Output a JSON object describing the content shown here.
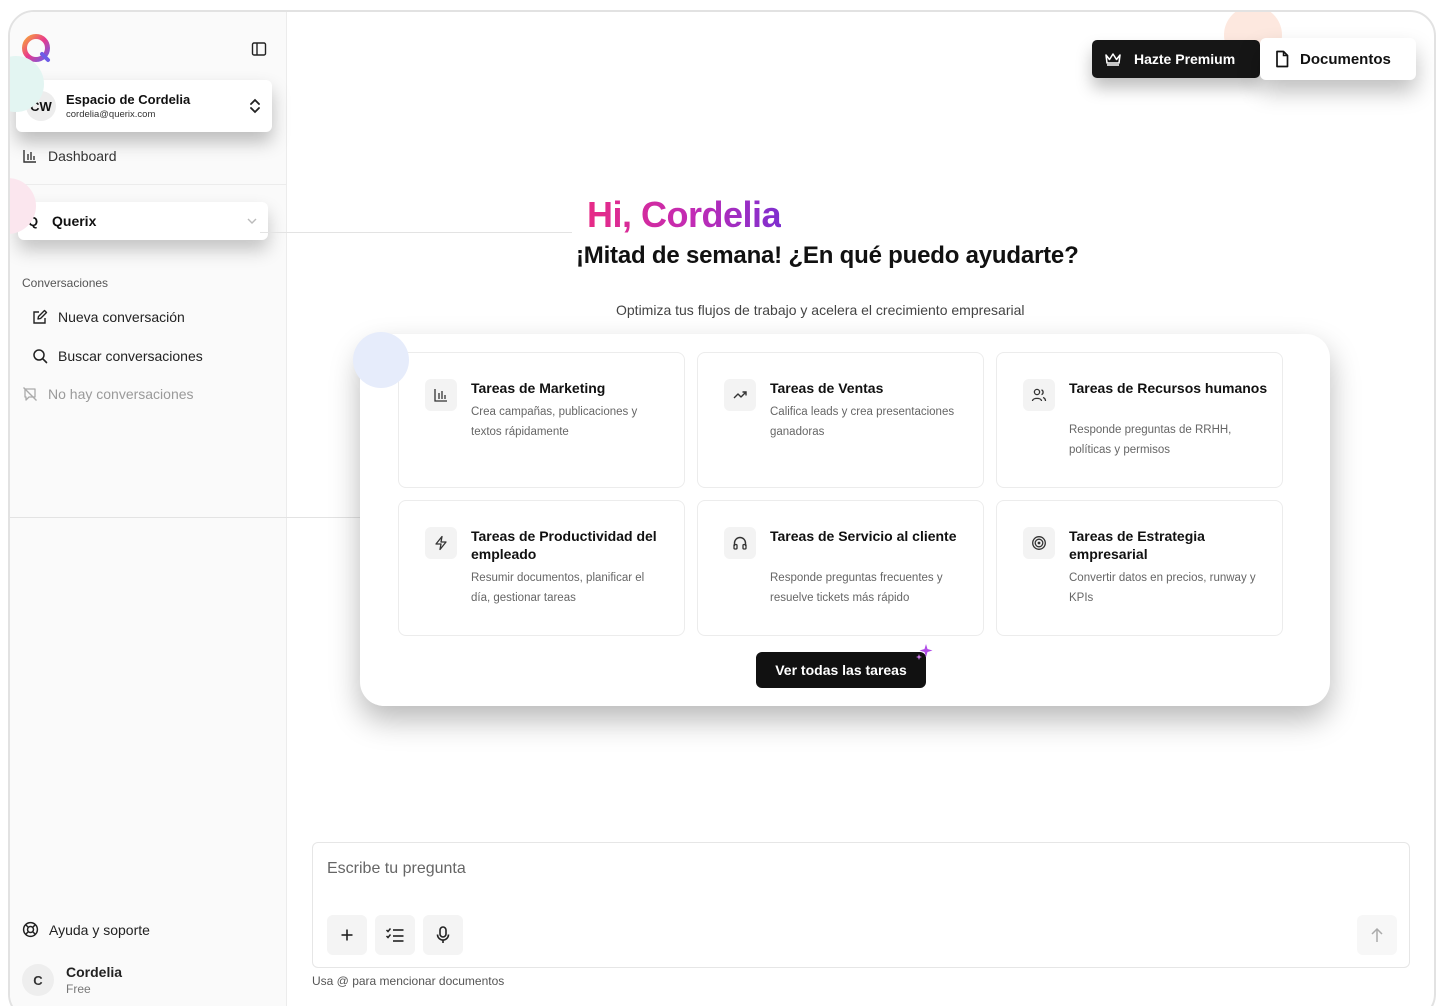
{
  "sidebar": {
    "workspace": {
      "initials": "CW",
      "name": "Espacio de Cordelia",
      "email": "cordelia@querix.com"
    },
    "dashboard_label": "Dashboard",
    "agent": {
      "initial": "Q",
      "name": "Querix"
    },
    "conversations_title": "Conversaciones",
    "new_conversation": "Nueva conversación",
    "search_conversations": "Buscar conversaciones",
    "empty_conversations": "No hay conversaciones",
    "help_label": "Ayuda y soporte",
    "user": {
      "initial": "C",
      "name": "Cordelia",
      "plan": "Free"
    }
  },
  "header": {
    "premium_label": "Hazte Premium",
    "documents_label": "Documentos"
  },
  "main": {
    "greeting": "Hi, Cordelia",
    "subgreeting": "¡Mitad de semana! ¿En qué puedo ayudarte?",
    "tagline": "Optimiza tus flujos de trabajo y acelera el crecimiento empresarial",
    "tasks": [
      {
        "title": "Tareas de Marketing",
        "description": "Crea campañas, publicaciones y textos rápidamente",
        "icon": "bar-chart-icon"
      },
      {
        "title": "Tareas de Ventas",
        "description": "Califica leads y crea presentaciones ganadoras",
        "icon": "trending-up-icon"
      },
      {
        "title": "Tareas de Recursos humanos",
        "description": "Responde preguntas de RRHH, políticas y permisos",
        "icon": "users-icon"
      },
      {
        "title": "Tareas de Productividad del empleado",
        "description": "Resumir documentos, planificar el día, gestionar tareas",
        "icon": "lightning-icon"
      },
      {
        "title": "Tareas de Servicio al cliente",
        "description": "Responde preguntas frecuentes y resuelve tickets más rápido",
        "icon": "headphones-icon"
      },
      {
        "title": "Tareas de Estrategia empresarial",
        "description": "Convertir datos en precios, runway y KPIs",
        "icon": "target-icon"
      }
    ],
    "view_all_label": "Ver todas las tareas"
  },
  "composer": {
    "placeholder": "Escribe tu pregunta",
    "value": "",
    "hint": "Usa @ para mencionar documentos"
  },
  "colors": {
    "greeting_gradient": [
      "#e72b86",
      "#c12bb5",
      "#7e2fcf"
    ],
    "dark_button": "#161616",
    "sparkle": "#b14de8"
  }
}
